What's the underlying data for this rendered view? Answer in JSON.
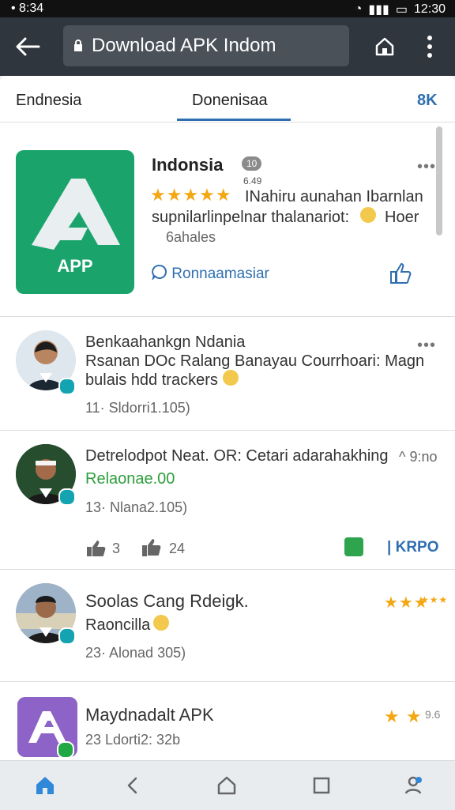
{
  "status": {
    "left": "• 8:34",
    "right": "12:30"
  },
  "urlbar": {
    "url": "Download APK Indom"
  },
  "tabs": {
    "left": "Endnesia",
    "center": "Donenisaa",
    "right": "8K"
  },
  "app": {
    "title": "Indonsia",
    "badge": "10",
    "subbadge": "6.49",
    "stars": "★★★★★",
    "line1": "INahiru aunahan Ibarnlan",
    "line2": "supnilarlinpelnar thalanariot:",
    "line2b": "Hoer",
    "line3": "6ahales",
    "link": "Ronnaamasiar",
    "icon_text": "APP"
  },
  "reviews": [
    {
      "title": "Benkaahankgn Ndania",
      "line1": "Rsanan DOc Ralang Banayau Courrhoari: Magn",
      "line2": "bulais hdd trackers",
      "meta": "11· Sldorri1.105)"
    },
    {
      "title": "Detrelodpot Neat. OR: Cetari adarahakhing",
      "time": "^ 9:no",
      "highlight": "Relaonae.00",
      "meta": "13· Nlana2.105)",
      "likes": "3",
      "dislikes": "24",
      "link": "| KRPO"
    },
    {
      "title": "Soolas Cang Rdeigk.",
      "line1": "Raoncilla",
      "meta": "23· Alonad 305)",
      "stars": "★★★",
      "stars_small": "★★★"
    },
    {
      "title": "Maydnadalt APK",
      "meta": "23 Ldorti2: 32b",
      "stars": "★ ★",
      "stars_small": "9.6"
    }
  ],
  "bottom_nav": {
    "home": "",
    "back": "",
    "home2": "",
    "recent": "",
    "profile": ""
  }
}
